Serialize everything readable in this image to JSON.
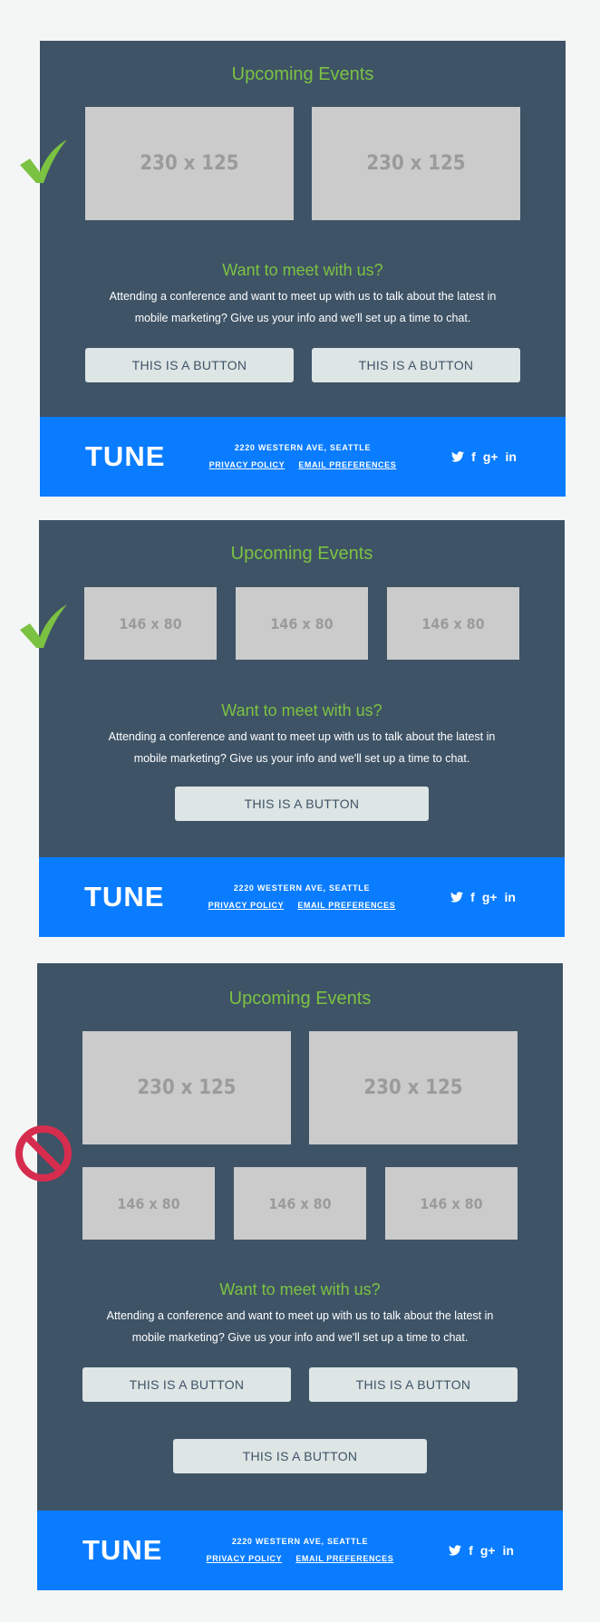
{
  "examples": [
    {
      "status": "good",
      "title": "Upcoming Events",
      "images_big": [
        "230 x 125",
        "230 x 125"
      ],
      "images_small": [],
      "subtitle": "Want to meet with us?",
      "description_line1": "Attending a conference and want to meet up with us to talk about the latest in",
      "description_line2": "mobile marketing? Give us your info and we'll set up a time to chat.",
      "buttons": [
        "THIS IS A BUTTON",
        "THIS IS A BUTTON"
      ],
      "footer": {
        "logo": "TUNE",
        "address": "2220 WESTERN AVE, SEATTLE",
        "privacy": "PRIVACY POLICY",
        "email_prefs": "EMAIL PREFERENCES",
        "social": {
          "facebook": "f",
          "googleplus": "g+",
          "linkedin": "in"
        }
      }
    },
    {
      "status": "good",
      "title": "Upcoming Events",
      "images_big": [],
      "images_small": [
        "146 x 80",
        "146 x 80",
        "146 x 80"
      ],
      "subtitle": "Want to meet with us?",
      "description_line1": "Attending a conference and want to meet up with us to talk about the latest in",
      "description_line2": "mobile marketing? Give us your info and we'll set up a time to chat.",
      "buttons": [
        "THIS IS A BUTTON"
      ],
      "footer": {
        "logo": "TUNE",
        "address": "2220 WESTERN AVE, SEATTLE",
        "privacy": "PRIVACY POLICY",
        "email_prefs": "EMAIL PREFERENCES",
        "social": {
          "facebook": "f",
          "googleplus": "g+",
          "linkedin": "in"
        }
      }
    },
    {
      "status": "bad",
      "title": "Upcoming Events",
      "images_big": [
        "230 x 125",
        "230 x 125"
      ],
      "images_small": [
        "146 x 80",
        "146 x 80",
        "146 x 80"
      ],
      "subtitle": "Want to meet with us?",
      "description_line1": "Attending a conference and want to meet up with us to talk about the latest in",
      "description_line2": "mobile marketing? Give us your info and we'll set up a time to chat.",
      "buttons": [
        "THIS IS A BUTTON",
        "THIS IS A BUTTON",
        "THIS IS A BUTTON"
      ],
      "footer": {
        "logo": "TUNE",
        "address": "2220 WESTERN AVE, SEATTLE",
        "privacy": "PRIVACY POLICY",
        "email_prefs": "EMAIL PREFERENCES",
        "social": {
          "facebook": "f",
          "googleplus": "g+",
          "linkedin": "in"
        }
      }
    }
  ],
  "colors": {
    "page_bg": "#f4f6f6",
    "card_bg": "#3e5366",
    "accent_green": "#7cc242",
    "footer_blue": "#0a7cff",
    "placeholder_bg": "#cbcbcb",
    "placeholder_text": "#9b9b9b",
    "button_bg": "#dde5e5",
    "button_text": "#3e5366",
    "check_green": "#7cc242",
    "no_red": "#d62d4f"
  },
  "icons": {
    "good": "checkmark-icon",
    "bad": "prohibited-icon",
    "twitter": "twitter-icon",
    "facebook": "facebook-icon",
    "googleplus": "googleplus-icon",
    "linkedin": "linkedin-icon"
  }
}
